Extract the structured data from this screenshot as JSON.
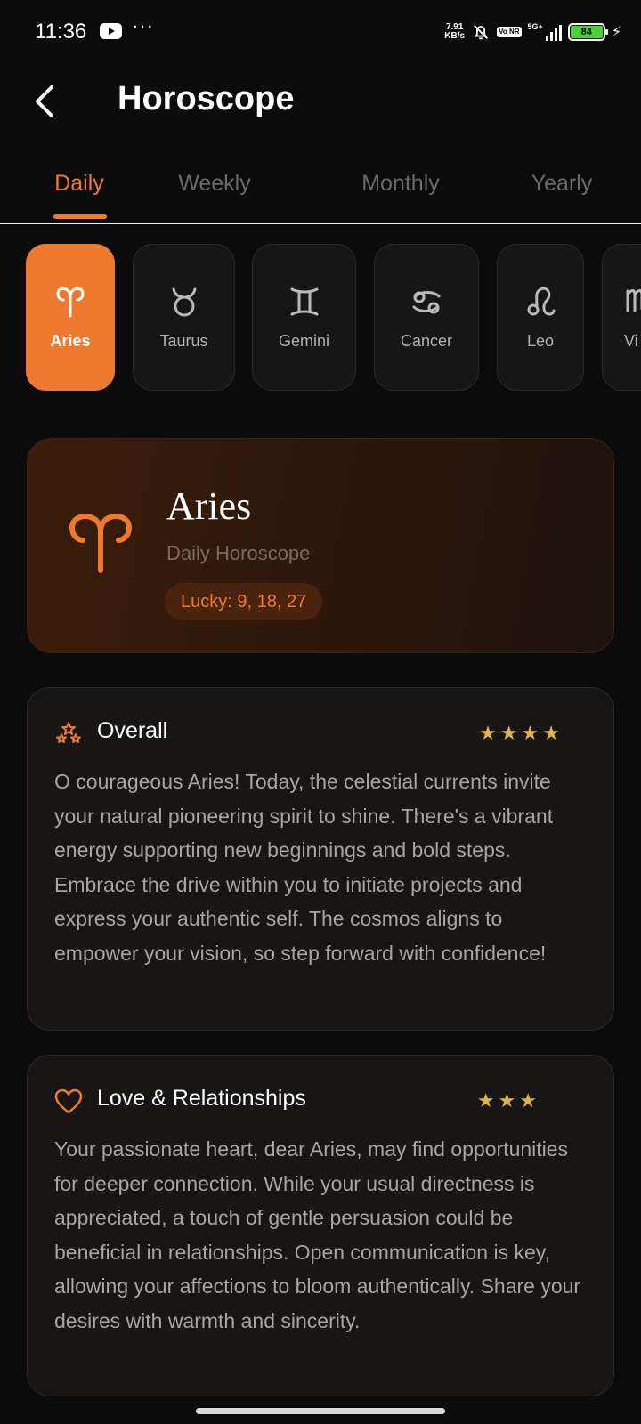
{
  "status_bar": {
    "time": "11:36",
    "dots": "···",
    "net_speed_value": "7.91",
    "net_speed_unit": "KB/s",
    "volte": "Vo NR",
    "signal_label": "5G+",
    "battery_level": "84"
  },
  "app_bar": {
    "title": "Horoscope"
  },
  "tabs": [
    {
      "label": "Daily",
      "active": true
    },
    {
      "label": "Weekly",
      "active": false
    },
    {
      "label": "Monthly",
      "active": false
    },
    {
      "label": "Yearly",
      "active": false
    }
  ],
  "zodiac_signs": [
    {
      "label": "Aries",
      "icon": "aries-icon",
      "active": true
    },
    {
      "label": "Taurus",
      "icon": "taurus-icon",
      "active": false
    },
    {
      "label": "Gemini",
      "icon": "gemini-icon",
      "active": false
    },
    {
      "label": "Cancer",
      "icon": "cancer-icon",
      "active": false
    },
    {
      "label": "Leo",
      "icon": "leo-icon",
      "active": false
    },
    {
      "label": "Vi",
      "icon": "virgo-icon",
      "active": false
    }
  ],
  "hero": {
    "sign": "Aries",
    "subtitle": "Daily Horoscope",
    "lucky": "Lucky: 9, 18, 27"
  },
  "sections": {
    "overall": {
      "title": "Overall",
      "icon": "constellation-icon",
      "stars": "★★★★",
      "rating": 4,
      "text": "O courageous Aries! Today, the celestial currents invite your natural pioneering spirit to shine. There's a vibrant energy supporting new beginnings and bold steps. Embrace the drive within you to initiate projects and express your authentic self. The cosmos aligns to empower your vision, so step forward with confidence!"
    },
    "love": {
      "title": "Love & Relationships",
      "icon": "heart-icon",
      "stars": "★★★",
      "rating": 3,
      "text": "Your passionate heart, dear Aries, may find opportunities for deeper connection. While your usual directness is appreciated, a touch of gentle persuasion could be beneficial in relationships. Open communication is key, allowing your affections to bloom authentically. Share your desires with warmth and sincerity."
    }
  },
  "colors": {
    "accent": "#f07a2c",
    "background": "#0b0b0b",
    "card": "#171615",
    "star": "#e0b24a"
  }
}
